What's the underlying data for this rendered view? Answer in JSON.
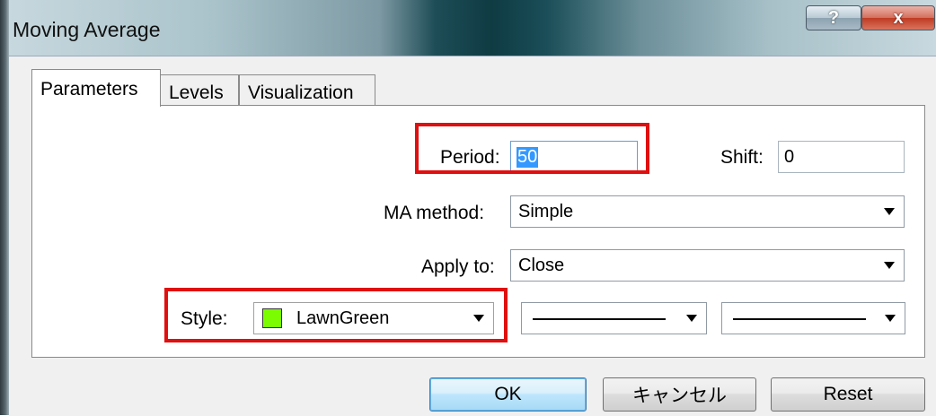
{
  "window": {
    "title": "Moving Average",
    "help_label": "?",
    "close_label": "x"
  },
  "tabs": [
    {
      "label": "Parameters",
      "active": true
    },
    {
      "label": "Levels",
      "active": false
    },
    {
      "label": "Visualization",
      "active": false
    }
  ],
  "fields": {
    "period": {
      "label": "Period:",
      "value": "50"
    },
    "shift": {
      "label": "Shift:",
      "value": "0"
    },
    "ma_method": {
      "label": "MA method:",
      "value": "Simple"
    },
    "apply_to": {
      "label": "Apply to:",
      "value": "Close"
    },
    "style": {
      "label": "Style:",
      "color_name": "LawnGreen",
      "color": "#7CFC00"
    }
  },
  "buttons": {
    "ok": "OK",
    "cancel": "キャンセル",
    "reset": "Reset"
  },
  "colors": {
    "highlight_border": "#E01010",
    "selection": "#3399FF"
  }
}
